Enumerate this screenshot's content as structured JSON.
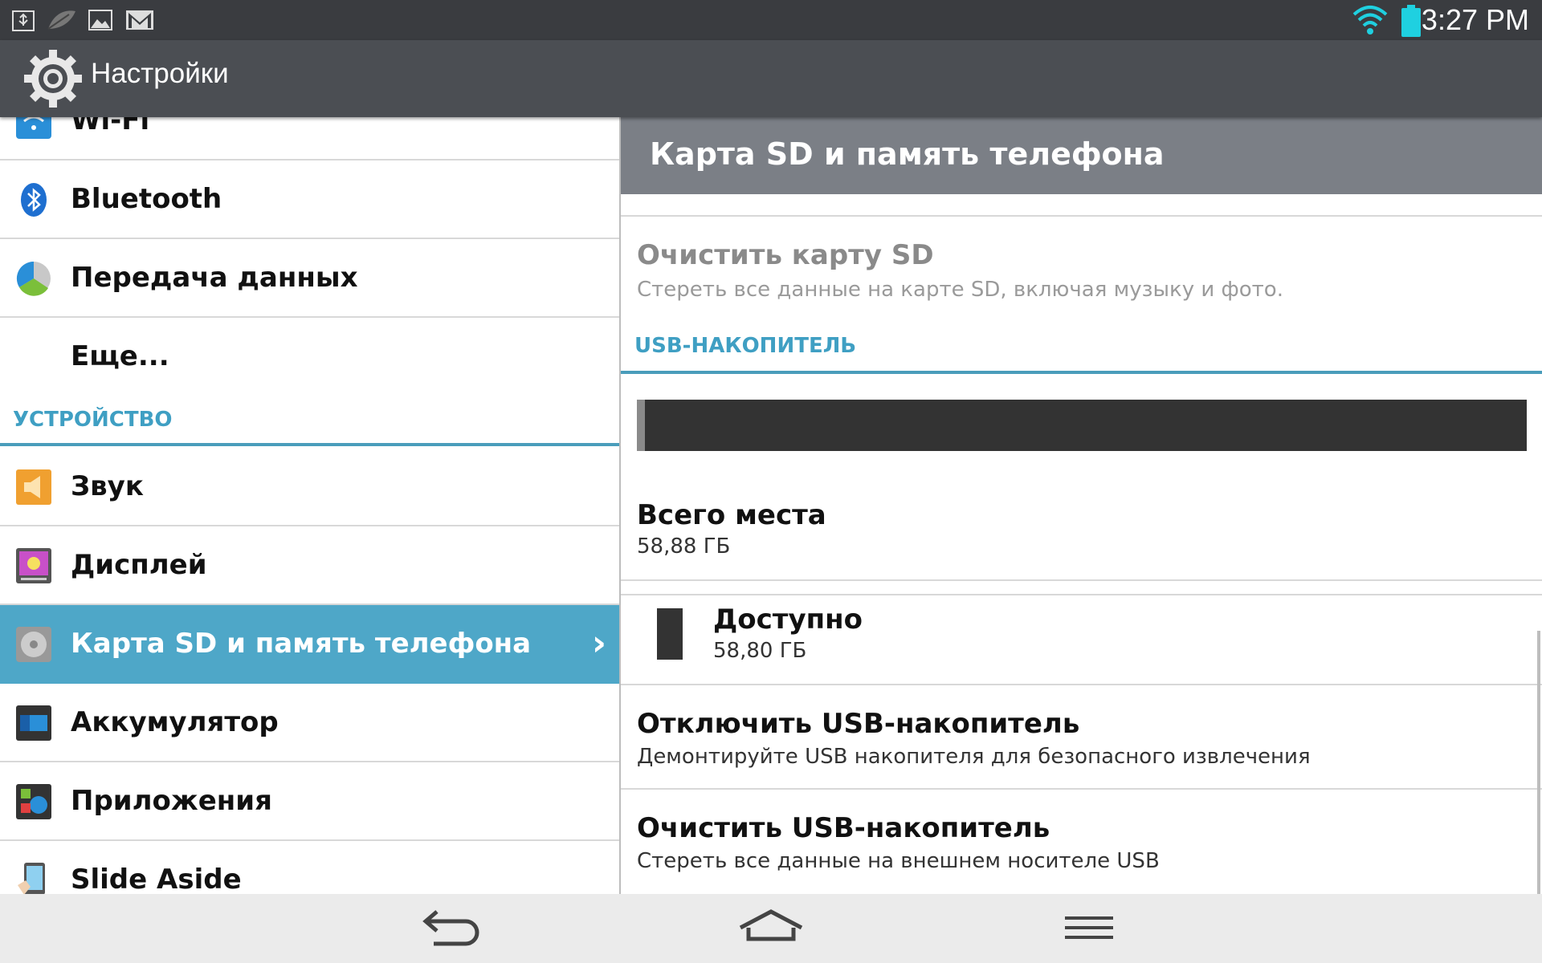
{
  "status_bar": {
    "time": "3:27 PM",
    "icons": [
      "usb-icon",
      "leaf-icon",
      "image-icon",
      "gmail-icon",
      "wifi-icon",
      "battery-icon"
    ]
  },
  "action_bar": {
    "title": "Настройки",
    "icon": "settings-gear-icon"
  },
  "sidebar": {
    "items": [
      {
        "label": "Wi-Fi",
        "icon": "wifi-settings-icon"
      },
      {
        "label": "Bluetooth",
        "icon": "bluetooth-icon"
      },
      {
        "label": "Передача данных",
        "icon": "data-usage-icon"
      },
      {
        "label": "Еще..."
      },
      {
        "label": "Звук",
        "icon": "sound-icon"
      },
      {
        "label": "Дисплей",
        "icon": "display-icon"
      },
      {
        "label": "Карта SD и память телефона",
        "icon": "storage-icon",
        "selected": true
      },
      {
        "label": "Аккумулятор",
        "icon": "battery-settings-icon"
      },
      {
        "label": "Приложения",
        "icon": "apps-icon"
      },
      {
        "label": "Slide Aside",
        "icon": "slide-aside-icon"
      }
    ],
    "section_device": "УСТРОЙСТВО"
  },
  "detail": {
    "title": "Карта SD и память телефона",
    "clear_sd": {
      "title": "Очистить карту SD",
      "summary": "Стереть все данные на карте SD, включая музыку и фото."
    },
    "usb_section": "USB-НАКОПИТЕЛЬ",
    "usage_fraction_used": 0.0014,
    "total": {
      "title": "Всего места",
      "value": "58,88 ГБ"
    },
    "available": {
      "title": "Доступно",
      "value": "58,80 ГБ"
    },
    "unmount_usb": {
      "title": "Отключить USB-накопитель",
      "summary": "Демонтируйте  USB накопителя для безопасного извлечения"
    },
    "clear_usb": {
      "title": "Очистить USB-накопитель",
      "summary": "Стереть все данные на внешнем носителе USB"
    }
  },
  "colors": {
    "accent": "#3f9fc3",
    "selected_row": "#4ea7c8",
    "status_bar": "#3a3c40",
    "action_bar": "#4b4e53",
    "detail_header": "#7b7f86"
  }
}
